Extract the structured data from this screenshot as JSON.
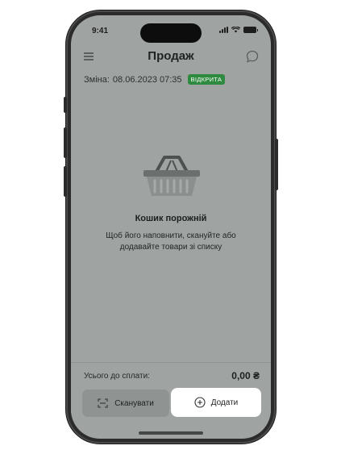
{
  "status_bar": {
    "time": "9:41"
  },
  "header": {
    "title": "Продаж"
  },
  "shift": {
    "label": "Зміна:",
    "datetime": "08.06.2023 07:35",
    "status": "ВІДКРИТА"
  },
  "cart": {
    "empty_title": "Кошик порожній",
    "empty_description": "Щоб його наповнити, скануйте або додавайте товари зі списку"
  },
  "footer": {
    "total_label": "Усього до сплати:",
    "total_value": "0,00 ₴",
    "scan_label": "Сканувати",
    "add_label": "Додати"
  },
  "colors": {
    "overlay": "#9fa3a1",
    "accent_green": "#2e8a3e",
    "add_button": "#ffffff",
    "phone_frame": "#2b2b2b"
  },
  "icons": [
    "menu-icon",
    "chat-icon",
    "basket-icon",
    "scan-icon",
    "plus-circle-icon",
    "signal-icon",
    "wifi-icon",
    "battery-icon"
  ]
}
